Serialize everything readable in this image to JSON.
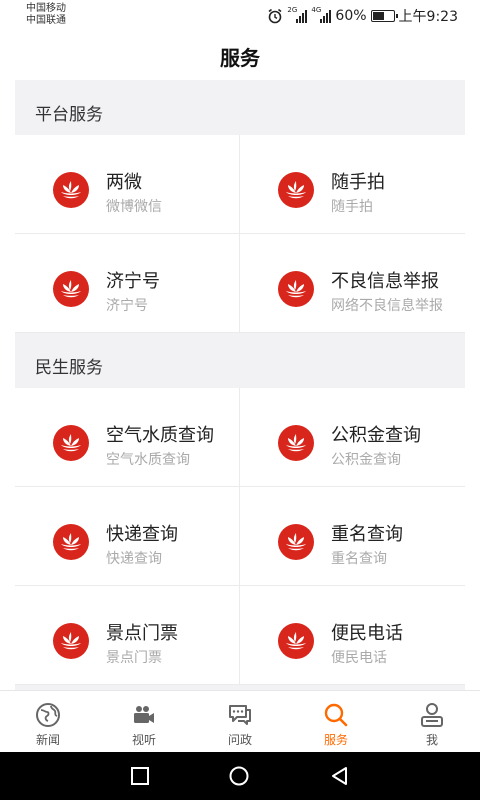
{
  "status_bar": {
    "carrier_1": "中国移动",
    "carrier_2": "中国联通",
    "network_1": "2G",
    "network_2": "4G",
    "battery_text": "60%",
    "battery_level": 0.6,
    "time": "上午9:23"
  },
  "header": {
    "title": "服务"
  },
  "sections": [
    {
      "title": "平台服务",
      "items": [
        {
          "title": "两微",
          "subtitle": "微博微信"
        },
        {
          "title": "随手拍",
          "subtitle": "随手拍"
        },
        {
          "title": "济宁号",
          "subtitle": "济宁号"
        },
        {
          "title": "不良信息举报",
          "subtitle": "网络不良信息举报"
        }
      ]
    },
    {
      "title": "民生服务",
      "items": [
        {
          "title": "空气水质查询",
          "subtitle": "空气水质查询"
        },
        {
          "title": "公积金查询",
          "subtitle": "公积金查询"
        },
        {
          "title": "快递查询",
          "subtitle": "快递查询"
        },
        {
          "title": "重名查询",
          "subtitle": "重名查询"
        },
        {
          "title": "景点门票",
          "subtitle": "景点门票"
        },
        {
          "title": "便民电话",
          "subtitle": "便民电话"
        }
      ]
    }
  ],
  "tabbar": {
    "tabs": [
      {
        "label": "新闻",
        "icon": "globe-icon"
      },
      {
        "label": "视听",
        "icon": "video-camera-icon"
      },
      {
        "label": "问政",
        "icon": "chat-icon"
      },
      {
        "label": "服务",
        "icon": "search-icon",
        "active": true
      },
      {
        "label": "我",
        "icon": "user-icon"
      }
    ],
    "active_color": "#ff6a00"
  },
  "colors": {
    "brand_red": "#d9261c",
    "accent_orange": "#ff6a00"
  }
}
